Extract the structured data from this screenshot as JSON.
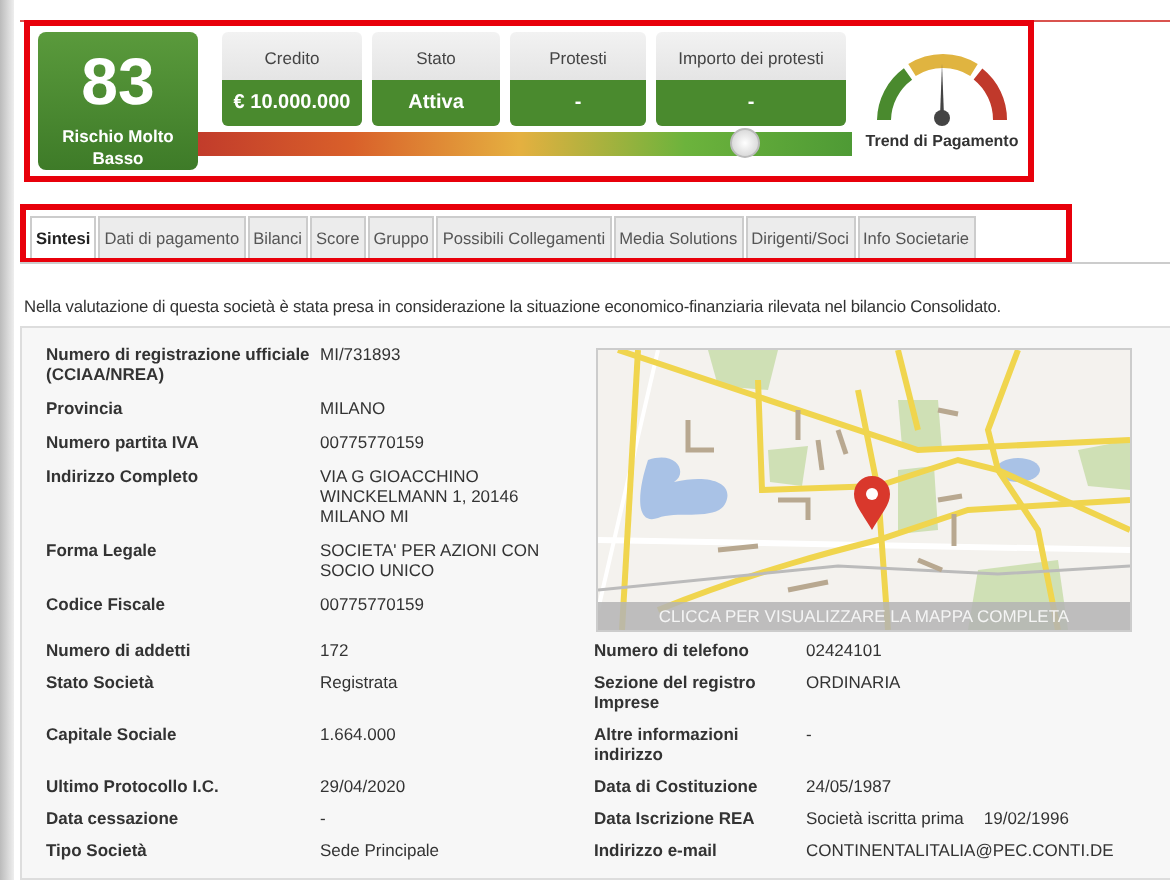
{
  "header": {
    "score": "83",
    "risk_label": "Rischio Molto Basso",
    "cards": [
      {
        "label": "Credito",
        "value": "€ 10.000.000"
      },
      {
        "label": "Stato",
        "value": "Attiva"
      },
      {
        "label": "Protesti",
        "value": "-"
      },
      {
        "label": "Importo dei protesti",
        "value": "-"
      }
    ],
    "risk_bar": {
      "level": 0.84
    },
    "gauge_label": "Trend di Pagamento"
  },
  "tabs": [
    {
      "label": "Sintesi",
      "selected": true
    },
    {
      "label": "Dati di pagamento",
      "selected": false
    },
    {
      "label": "Bilanci",
      "selected": false
    },
    {
      "label": "Score",
      "selected": false
    },
    {
      "label": "Gruppo",
      "selected": false
    },
    {
      "label": "Possibili Collegamenti",
      "selected": false
    },
    {
      "label": "Media Solutions",
      "selected": false
    },
    {
      "label": "Dirigenti/Soci",
      "selected": false
    },
    {
      "label": "Info Societarie",
      "selected": false
    }
  ],
  "note": "Nella valutazione di questa società è stata presa in considerazione la situazione economico-finanziaria rilevata nel bilancio Consolidato.",
  "fields": [
    {
      "label": "Numero di registrazione ufficiale (CCIAA/NREA)",
      "value": "MI/731893"
    },
    {
      "label": "Provincia",
      "value": "MILANO"
    },
    {
      "label": "Numero partita IVA",
      "value": "00775770159"
    },
    {
      "label": "Indirizzo Completo",
      "value": "VIA G GIOACCHINO WINCKELMANN 1, 20146 MILANO MI"
    },
    {
      "label": "Forma Legale",
      "value": "SOCIETA' PER AZIONI CON SOCIO UNICO"
    },
    {
      "label": "Codice Fiscale",
      "value": "00775770159"
    }
  ],
  "map": {
    "caption": "CLICCA PER VISUALIZZARE LA MAPPA COMPLETA"
  },
  "rows": [
    {
      "left": {
        "label": "Numero di addetti",
        "value": "172"
      },
      "right": {
        "label": "Numero di telefono",
        "value": "02424101"
      }
    },
    {
      "left": {
        "label": "Stato Società",
        "value": "Registrata"
      },
      "right": {
        "label": "Sezione del registro Imprese",
        "value": "ORDINARIA"
      }
    },
    {
      "left": {
        "label": "Capitale Sociale",
        "value": "1.664.000"
      },
      "right": {
        "label": "Altre informazioni indirizzo",
        "value": "-"
      }
    },
    {
      "left": {
        "label": "Ultimo Protocollo I.C.",
        "value": "29/04/2020"
      },
      "right": {
        "label": "Data di Costituzione",
        "value": "24/05/1987"
      }
    },
    {
      "left": {
        "label": "Data cessazione",
        "value": "-"
      },
      "right": {
        "label": "Data Iscrizione REA",
        "value": "Società iscritta prima",
        "value_2": "19/02/1996"
      }
    },
    {
      "left": {
        "label": "Tipo Società",
        "value": "Sede Principale"
      },
      "right": {
        "label": "Indirizzo e-mail",
        "value": "CONTINENTALITALIA@PEC.CONTI.DE"
      }
    }
  ]
}
